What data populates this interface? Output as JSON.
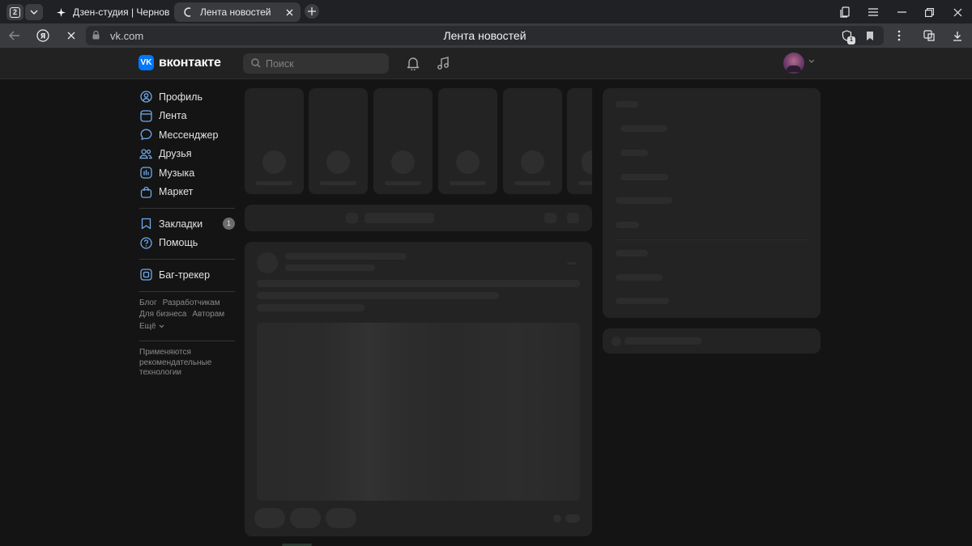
{
  "browser": {
    "tab_count": "2",
    "tabs": [
      {
        "label": "Дзен-студия | Черновик",
        "icon": "sparkle-icon"
      },
      {
        "label": "Лента новостей",
        "icon": "loading-spinner-icon"
      }
    ],
    "url": "vk.com",
    "page_title": "Лента новостей",
    "extension_badge": "1"
  },
  "header": {
    "logo_text": "вконтакте",
    "search_placeholder": "Поиск"
  },
  "nav": {
    "main": [
      {
        "label": "Профиль",
        "icon": "profile-icon"
      },
      {
        "label": "Лента",
        "icon": "feed-icon"
      },
      {
        "label": "Мессенджер",
        "icon": "messenger-icon"
      },
      {
        "label": "Друзья",
        "icon": "friends-icon"
      },
      {
        "label": "Музыка",
        "icon": "music-icon"
      },
      {
        "label": "Маркет",
        "icon": "market-icon"
      }
    ],
    "secondary": [
      {
        "label": "Закладки",
        "icon": "bookmark-icon",
        "badge": "1"
      },
      {
        "label": "Помощь",
        "icon": "help-icon"
      }
    ],
    "tools": [
      {
        "label": "Баг-трекер",
        "icon": "bug-tracker-icon"
      }
    ],
    "footer_links": [
      "Блог",
      "Разработчикам",
      "Для бизнеса",
      "Авторам",
      "Ещё"
    ],
    "footer_note": "Применяются рекомендательные технологии"
  },
  "colors": {
    "page_bg": "#141414",
    "card_bg": "#232323",
    "skeleton": "#2c2c2c",
    "accent": "#0077ff",
    "header_bg": "#222222"
  }
}
